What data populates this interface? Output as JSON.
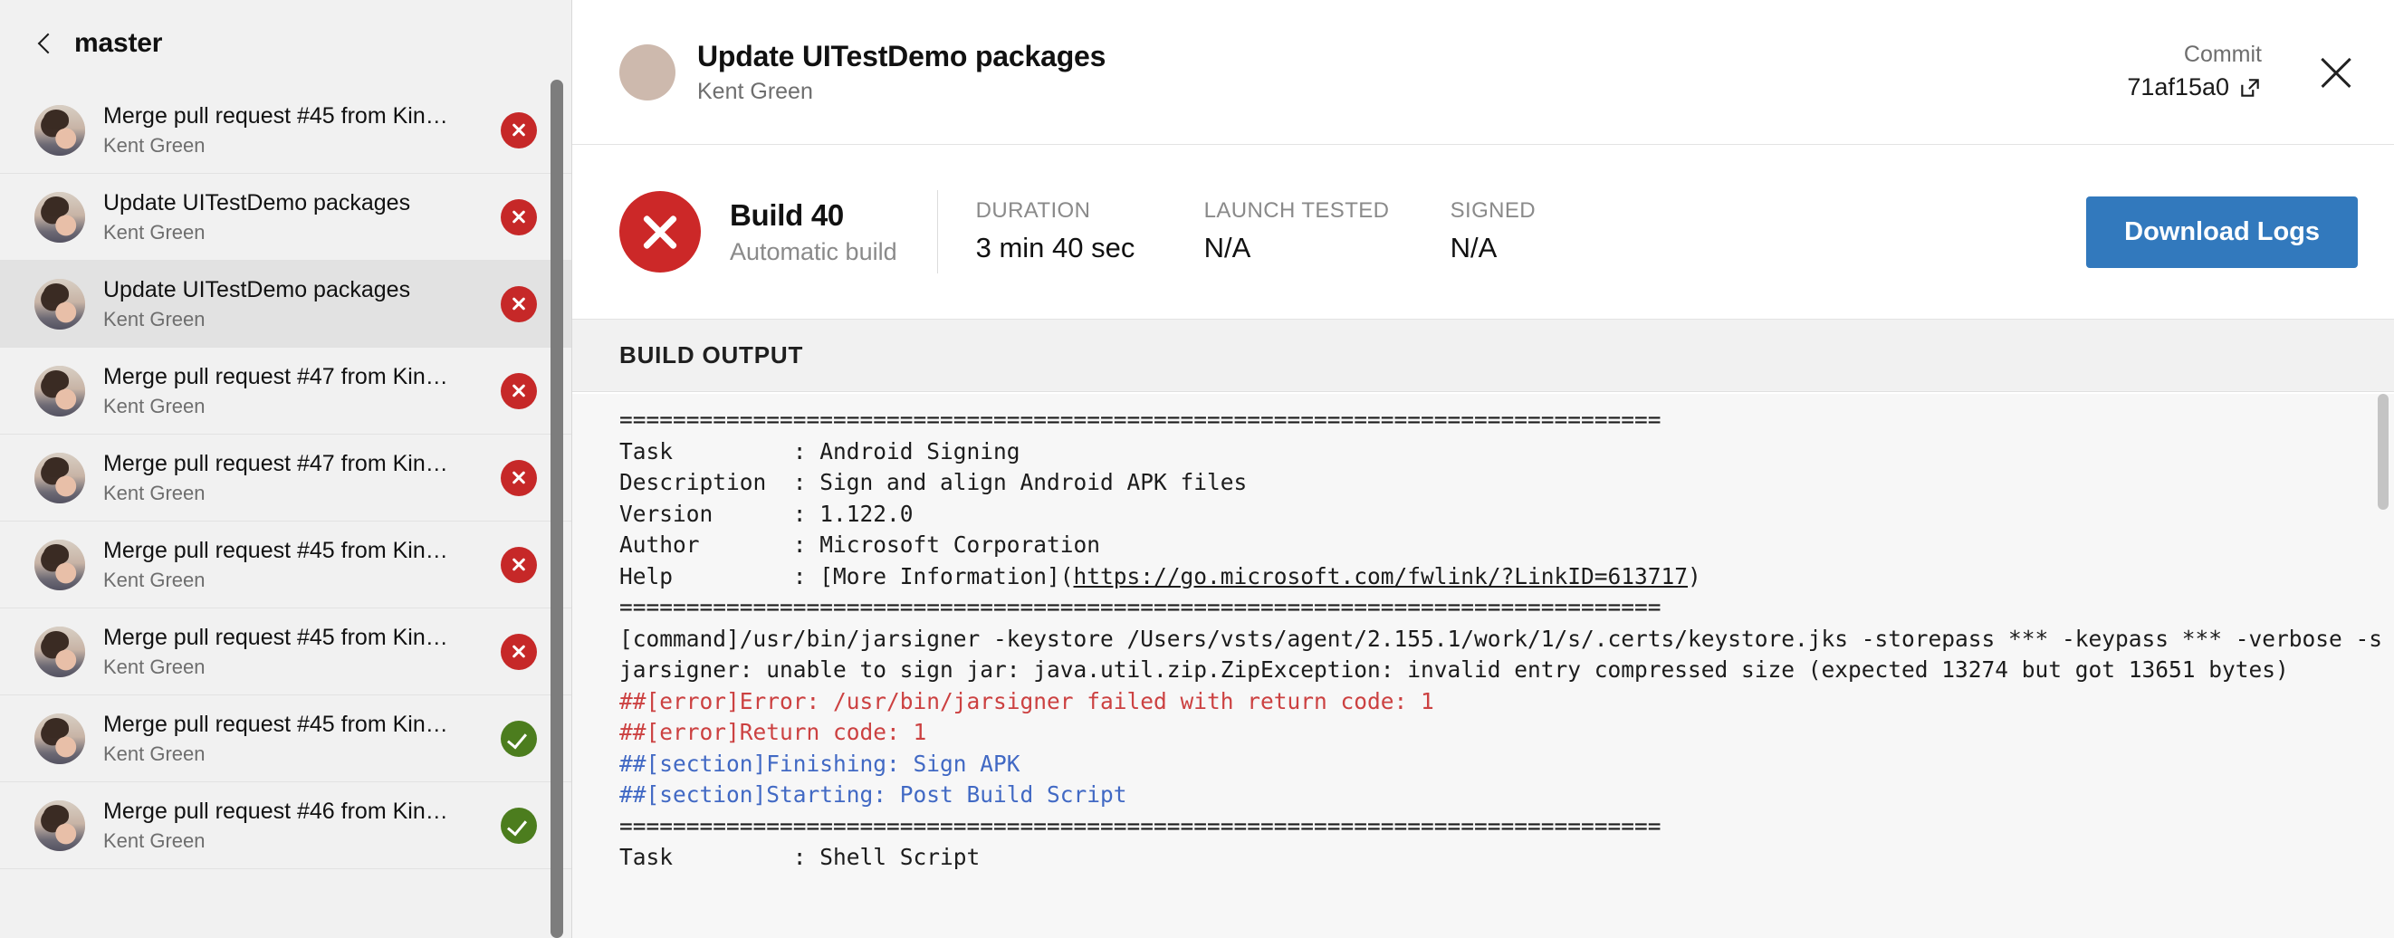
{
  "sidebar": {
    "back_icon": "chevron-left-icon",
    "branch": "master",
    "author_default": "Kent Green",
    "commits": [
      {
        "title": "Merge pull request #45 from Kin…",
        "author": "Kent Green",
        "status": "fail",
        "selected": false
      },
      {
        "title": "Update UITestDemo packages",
        "author": "Kent Green",
        "status": "fail",
        "selected": false
      },
      {
        "title": "Update UITestDemo packages",
        "author": "Kent Green",
        "status": "fail",
        "selected": true
      },
      {
        "title": "Merge pull request #47 from Kin…",
        "author": "Kent Green",
        "status": "fail",
        "selected": false
      },
      {
        "title": "Merge pull request #47 from Kin…",
        "author": "Kent Green",
        "status": "fail",
        "selected": false
      },
      {
        "title": "Merge pull request #45 from Kin…",
        "author": "Kent Green",
        "status": "fail",
        "selected": false
      },
      {
        "title": "Merge pull request #45 from Kin…",
        "author": "Kent Green",
        "status": "fail",
        "selected": false
      },
      {
        "title": "Merge pull request #45 from Kin…",
        "author": "Kent Green",
        "status": "pass",
        "selected": false
      },
      {
        "title": "Merge pull request #46 from Kin…",
        "author": "Kent Green",
        "status": "pass",
        "selected": false
      }
    ]
  },
  "header": {
    "title": "Update UITestDemo packages",
    "subtitle": "Kent Green",
    "commit_label": "Commit",
    "commit_hash": "71af15a0",
    "external_link_icon": "external-link-icon",
    "close_icon": "close-icon"
  },
  "status_strip": {
    "status_icon": "failed-x-icon",
    "build_name": "Build 40",
    "build_kind": "Automatic build",
    "metrics": [
      {
        "label": "DURATION",
        "value": "3 min 40 sec"
      },
      {
        "label": "LAUNCH TESTED",
        "value": "N/A"
      },
      {
        "label": "SIGNED",
        "value": "N/A"
      }
    ],
    "download_label": "Download Logs",
    "accent_blue": "#3279bd",
    "fail_red": "#cc2828",
    "pass_green": "#4c7d1e"
  },
  "build_output": {
    "section_title": "BUILD OUTPUT",
    "lines": [
      {
        "kind": "plain",
        "text": "=============================================================================="
      },
      {
        "kind": "plain",
        "text": "Task         : Android Signing"
      },
      {
        "kind": "plain",
        "text": "Description  : Sign and align Android APK files"
      },
      {
        "kind": "plain",
        "text": "Version      : 1.122.0"
      },
      {
        "kind": "plain",
        "text": "Author       : Microsoft Corporation"
      },
      {
        "kind": "link",
        "pre": "Help         : [More Information](",
        "link": "https://go.microsoft.com/fwlink/?LinkID=613717",
        "post": ")"
      },
      {
        "kind": "plain",
        "text": "=============================================================================="
      },
      {
        "kind": "plain",
        "text": "[command]/usr/bin/jarsigner -keystore /Users/vsts/agent/2.155.1/work/1/s/.certs/keystore.jks -storepass *** -keypass *** -verbose -s"
      },
      {
        "kind": "plain",
        "text": "jarsigner: unable to sign jar: java.util.zip.ZipException: invalid entry compressed size (expected 13274 but got 13651 bytes)"
      },
      {
        "kind": "error",
        "text": "##[error]Error: /usr/bin/jarsigner failed with return code: 1"
      },
      {
        "kind": "error",
        "text": "##[error]Return code: 1"
      },
      {
        "kind": "section",
        "text": "##[section]Finishing: Sign APK"
      },
      {
        "kind": "section",
        "text": "##[section]Starting: Post Build Script"
      },
      {
        "kind": "plain",
        "text": ""
      },
      {
        "kind": "plain",
        "text": "=============================================================================="
      },
      {
        "kind": "plain",
        "text": "Task         : Shell Script"
      }
    ]
  }
}
